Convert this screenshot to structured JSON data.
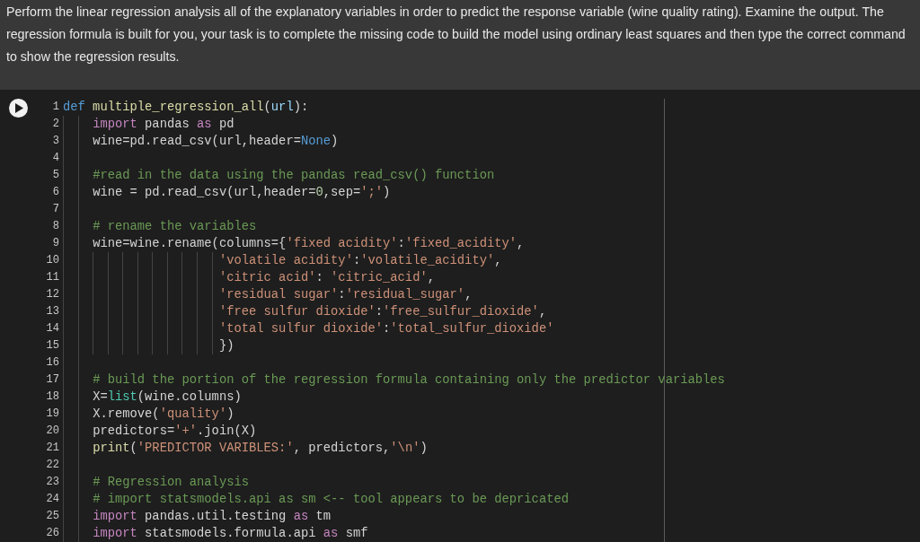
{
  "instructions": "Perform the linear regression analysis all of the explanatory variables in order to predict the response variable (wine quality rating). Examine the output. The regression formula is built for you, your task is to complete the missing code to build the model using ordinary least squares and then type the correct command to show the regression results.",
  "cell": {
    "lines": [
      {
        "number": "1",
        "tokens": [
          {
            "kind": "const",
            "text": "def"
          },
          {
            "kind": "fn",
            "text": " multiple_regression_all"
          },
          {
            "kind": "plain",
            "text": "("
          },
          {
            "kind": "param",
            "text": "url"
          },
          {
            "kind": "plain",
            "text": "):"
          }
        ]
      },
      {
        "number": "2",
        "tokens": [
          {
            "kind": "kw",
            "text": "    import"
          },
          {
            "kind": "plain",
            "text": " pandas "
          },
          {
            "kind": "kw",
            "text": "as"
          },
          {
            "kind": "plain",
            "text": " pd"
          }
        ]
      },
      {
        "number": "3",
        "tokens": [
          {
            "kind": "plain",
            "text": "    wine=pd.read_csv(url,header="
          },
          {
            "kind": "const",
            "text": "None"
          },
          {
            "kind": "plain",
            "text": ")"
          }
        ]
      },
      {
        "number": "4"
      },
      {
        "number": "5",
        "tokens": [
          {
            "kind": "comment",
            "text": "    #read in the data using the pandas read_csv() function"
          }
        ]
      },
      {
        "number": "6",
        "tokens": [
          {
            "kind": "plain",
            "text": "    wine = pd.read_csv(url,header="
          },
          {
            "kind": "num",
            "text": "0"
          },
          {
            "kind": "plain",
            "text": ",sep="
          },
          {
            "kind": "str",
            "text": "';'"
          },
          {
            "kind": "plain",
            "text": ")"
          }
        ]
      },
      {
        "number": "7"
      },
      {
        "number": "8",
        "tokens": [
          {
            "kind": "comment",
            "text": "    # rename the variables"
          }
        ]
      },
      {
        "number": "9",
        "tokens": [
          {
            "kind": "plain",
            "text": "    wine=wine.rename(columns={"
          },
          {
            "kind": "str",
            "text": "'fixed acidity'"
          },
          {
            "kind": "plain",
            "text": ":"
          },
          {
            "kind": "str",
            "text": "'fixed_acidity'"
          },
          {
            "kind": "plain",
            "text": ","
          }
        ]
      },
      {
        "number": "10",
        "tokens": [
          {
            "kind": "str",
            "text": "                     'volatile acidity'"
          },
          {
            "kind": "plain",
            "text": ":"
          },
          {
            "kind": "str",
            "text": "'volatile_acidity'"
          },
          {
            "kind": "plain",
            "text": ","
          }
        ]
      },
      {
        "number": "11",
        "tokens": [
          {
            "kind": "str",
            "text": "                     'citric acid'"
          },
          {
            "kind": "plain",
            "text": ": "
          },
          {
            "kind": "str",
            "text": "'citric_acid'"
          },
          {
            "kind": "plain",
            "text": ","
          }
        ]
      },
      {
        "number": "12",
        "tokens": [
          {
            "kind": "str",
            "text": "                     'residual sugar'"
          },
          {
            "kind": "plain",
            "text": ":"
          },
          {
            "kind": "str",
            "text": "'residual_sugar'"
          },
          {
            "kind": "plain",
            "text": ","
          }
        ]
      },
      {
        "number": "13",
        "tokens": [
          {
            "kind": "str",
            "text": "                     'free sulfur dioxide'"
          },
          {
            "kind": "plain",
            "text": ":"
          },
          {
            "kind": "str",
            "text": "'free_sulfur_dioxide'"
          },
          {
            "kind": "plain",
            "text": ","
          }
        ]
      },
      {
        "number": "14",
        "tokens": [
          {
            "kind": "str",
            "text": "                     'total sulfur dioxide'"
          },
          {
            "kind": "plain",
            "text": ":"
          },
          {
            "kind": "str",
            "text": "'total_sulfur_dioxide'"
          }
        ]
      },
      {
        "number": "15",
        "tokens": [
          {
            "kind": "plain",
            "text": "                     })"
          }
        ]
      },
      {
        "number": "16"
      },
      {
        "number": "17",
        "tokens": [
          {
            "kind": "comment",
            "text": "    # build the portion of the regression formula containing only the predictor variables"
          }
        ]
      },
      {
        "number": "18",
        "tokens": [
          {
            "kind": "plain",
            "text": "    X="
          },
          {
            "kind": "builtin",
            "text": "list"
          },
          {
            "kind": "plain",
            "text": "(wine.columns)"
          }
        ]
      },
      {
        "number": "19",
        "tokens": [
          {
            "kind": "plain",
            "text": "    X.remove("
          },
          {
            "kind": "str",
            "text": "'quality'"
          },
          {
            "kind": "plain",
            "text": ")"
          }
        ]
      },
      {
        "number": "20",
        "tokens": [
          {
            "kind": "plain",
            "text": "    predictors="
          },
          {
            "kind": "str",
            "text": "'+'"
          },
          {
            "kind": "plain",
            "text": ".join(X)"
          }
        ]
      },
      {
        "number": "21",
        "tokens": [
          {
            "kind": "fn",
            "text": "    print"
          },
          {
            "kind": "plain",
            "text": "("
          },
          {
            "kind": "str",
            "text": "'PREDICTOR VARIBLES:'"
          },
          {
            "kind": "plain",
            "text": ", predictors,"
          },
          {
            "kind": "str",
            "text": "'\\n'"
          },
          {
            "kind": "plain",
            "text": ")"
          }
        ]
      },
      {
        "number": "22"
      },
      {
        "number": "23",
        "tokens": [
          {
            "kind": "comment",
            "text": "    # Regression analysis"
          }
        ]
      },
      {
        "number": "24",
        "tokens": [
          {
            "kind": "comment",
            "text": "    # import statsmodels.api as sm <-- tool appears to be depricated"
          }
        ]
      },
      {
        "number": "25",
        "tokens": [
          {
            "kind": "kw",
            "text": "    import"
          },
          {
            "kind": "plain",
            "text": " pandas.util.testing "
          },
          {
            "kind": "kw",
            "text": "as"
          },
          {
            "kind": "plain",
            "text": " tm"
          }
        ]
      },
      {
        "number": "26",
        "tokens": [
          {
            "kind": "kw",
            "text": "    import"
          },
          {
            "kind": "plain",
            "text": " statsmodels.formula.api "
          },
          {
            "kind": "kw",
            "text": "as"
          },
          {
            "kind": "plain",
            "text": " smf"
          }
        ]
      }
    ]
  }
}
